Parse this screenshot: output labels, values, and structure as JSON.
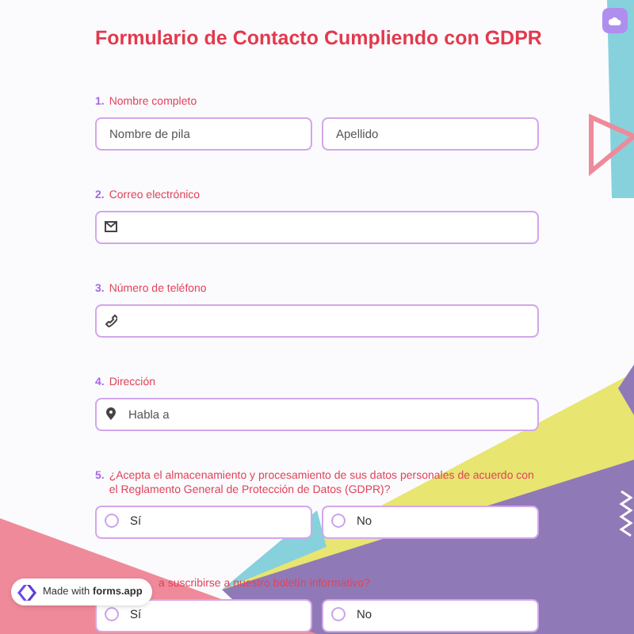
{
  "title": "Formulario de Contacto Cumpliendo con GDPR",
  "questions": [
    {
      "number": "1.",
      "label": "Nombre completo",
      "kind": "name",
      "fields": [
        {
          "placeholder": "Nombre de pila"
        },
        {
          "placeholder": "Apellido"
        }
      ]
    },
    {
      "number": "2.",
      "label": "Correo electrónico",
      "kind": "email"
    },
    {
      "number": "3.",
      "label": "Número de teléfono",
      "kind": "phone"
    },
    {
      "number": "4.",
      "label": "Dirección",
      "kind": "address",
      "placeholder": "Habla a"
    },
    {
      "number": "5.",
      "label": "¿Acepta el almacenamiento y procesamiento de sus datos personales de acuerdo con el Reglamento General de Protección de Datos (GDPR)?",
      "kind": "choice",
      "options": [
        {
          "label": "Sí",
          "selected": false
        },
        {
          "label": "No",
          "selected": false
        }
      ]
    },
    {
      "label": "a suscribirse a nuestro boletín informativo?",
      "kind": "choice",
      "options": [
        {
          "label": "Sí",
          "selected": false
        },
        {
          "label": "No",
          "selected": false
        }
      ]
    }
  ],
  "badge": {
    "text": "Made with **forms.app**"
  }
}
